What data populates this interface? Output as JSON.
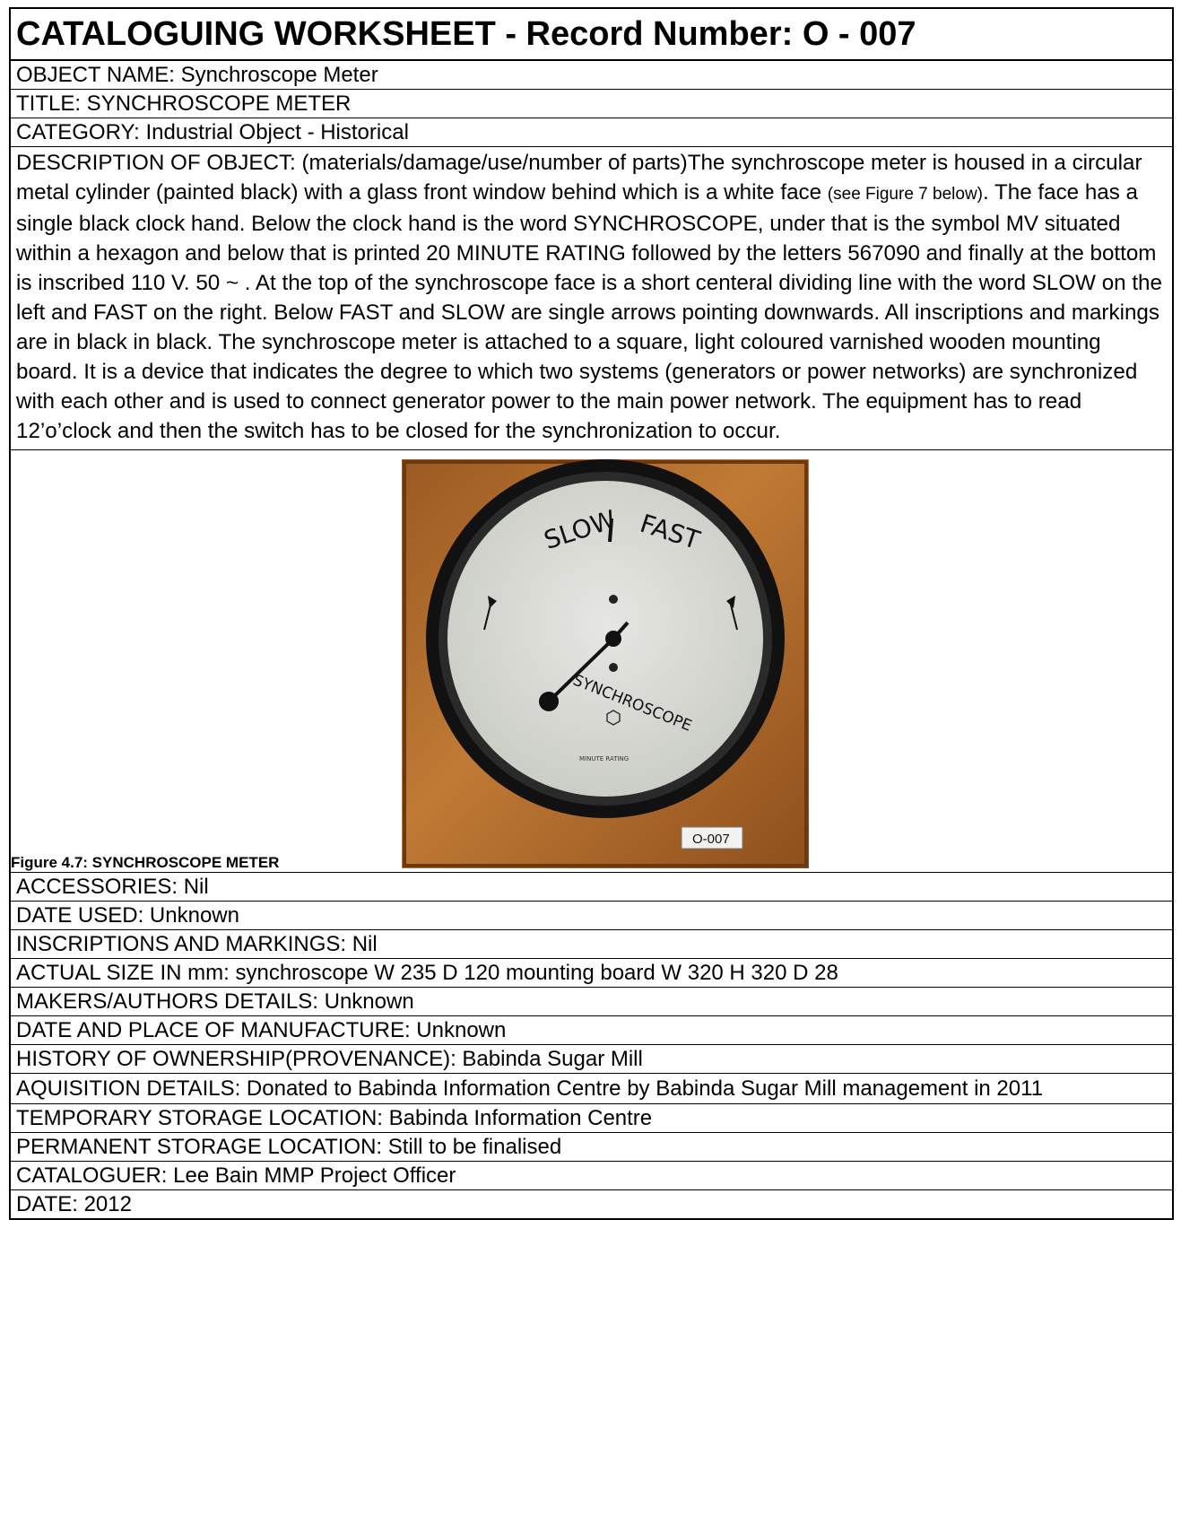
{
  "worksheet": {
    "title": "CATALOGUING WORKSHEET  - Record Number: O - 007",
    "object_name": "OBJECT NAME: Synchroscope Meter",
    "title_field": "TITLE: SYNCHROSCOPE METER",
    "category": "CATEGORY: Industrial Object - Historical",
    "description": {
      "part1": "DESCRIPTION OF OBJECT: (materials/damage/use/number of parts)The synchroscope meter is housed in a circular metal cylinder (painted black) with a glass front window behind which is a white face ",
      "note": "(see Figure 7 below)",
      "part2": ". The face has a single black clock hand. Below the clock hand is the word SYNCHROSCOPE, under that is the symbol MV situated within a hexagon and below that is printed 20 MINUTE RATING followed by the letters 567090 and finally at the bottom is inscribed 110 V.   50 ~ . At the top of the synchroscope face is a short centeral dividing line with the word SLOW on the left and FAST on the right. Below FAST and SLOW are single arrows pointing downwards. All inscriptions and markings are in black in black. The synchroscope meter is attached to a square, light coloured varnished wooden mounting board. It is a device that indicates the degree to which two systems (generators or power networks) are synchronized with each other and is used to connect generator power to the main power network. The equipment has to read 12’o’clock and then the switch has to be closed for the synchronization to occur."
    },
    "figure": {
      "caption": "Figure 4.7: SYNCHROSCOPE METER",
      "dial_slow": "SLOW",
      "dial_fast": "FAST",
      "dial_word": "SYNCHROSCOPE",
      "dial_rating": "MINUTE RATING",
      "label": "O-007"
    },
    "accessories": "ACCESSORIES: Nil",
    "date_used": "DATE USED: Unknown",
    "inscriptions": "INSCRIPTIONS AND MARKINGS: Nil",
    "actual_size": "ACTUAL SIZE IN mm: synchroscope W 235  D  120 mounting board W 320 H 320  D 28",
    "makers": "MAKERS/AUTHORS DETAILS: Unknown",
    "manufacture": "DATE AND PLACE OF MANUFACTURE: Unknown",
    "history": "HISTORY OF OWNERSHIP(PROVENANCE):  Babinda Sugar Mill",
    "acquisition": "AQUISITION DETAILS: Donated to Babinda Information Centre by Babinda Sugar Mill management in 2011",
    "temp_storage": "TEMPORARY STORAGE LOCATION: Babinda Information Centre",
    "perm_storage": "PERMANENT STORAGE LOCATION: Still to be finalised",
    "cataloguer": "CATALOGUER: Lee Bain MMP Project Officer",
    "date": "DATE:   2012"
  }
}
